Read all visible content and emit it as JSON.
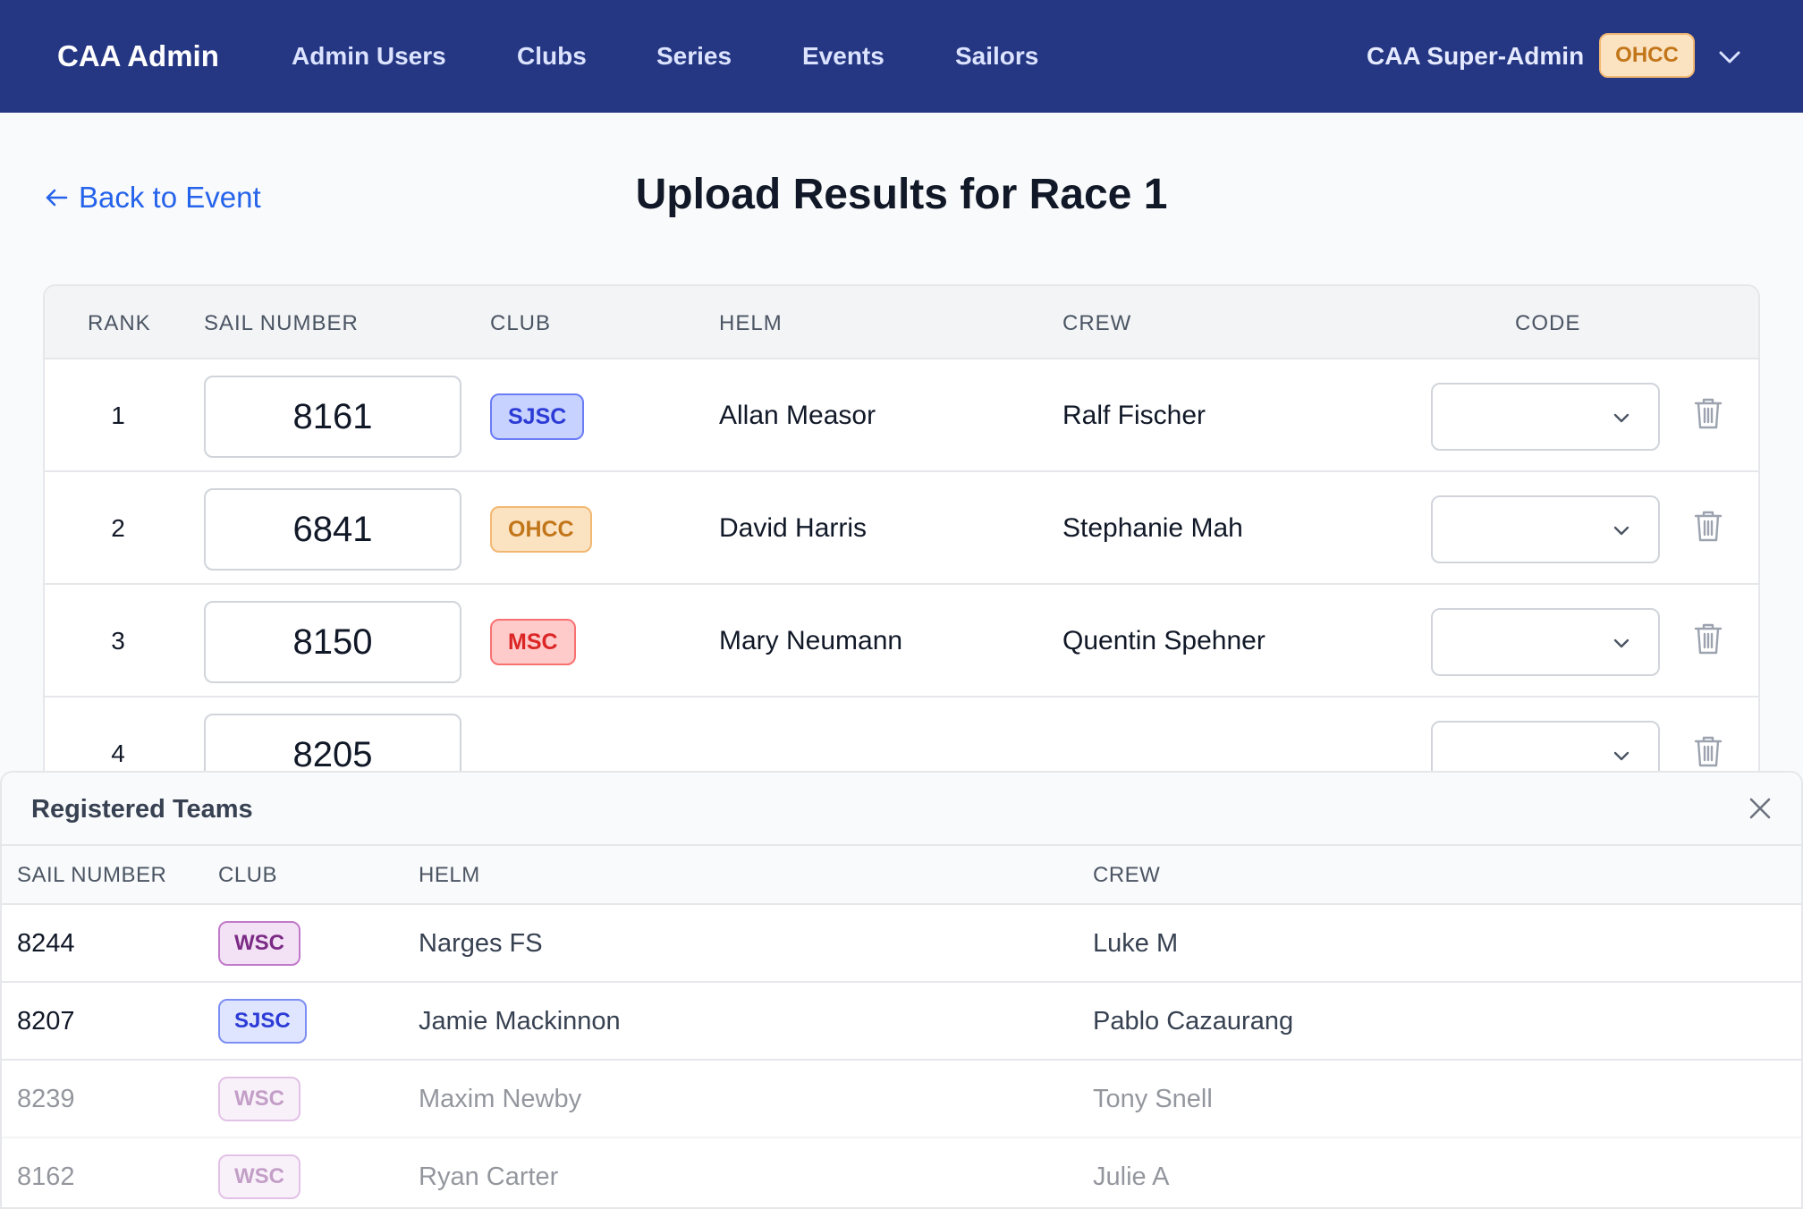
{
  "nav": {
    "brand": "CAA Admin",
    "links": [
      "Admin Users",
      "Clubs",
      "Series",
      "Events",
      "Sailors"
    ],
    "user_label": "CAA Super-Admin",
    "club_badge": "OHCC"
  },
  "header": {
    "back_label": "Back to Event",
    "title": "Upload Results for Race 1"
  },
  "results": {
    "columns": [
      "RANK",
      "SAIL NUMBER",
      "CLUB",
      "HELM",
      "CREW",
      "CODE"
    ],
    "rows": [
      {
        "rank": "1",
        "sail": "8161",
        "club": "SJSC",
        "helm": "Allan Measor",
        "crew": "Ralf Fischer",
        "code": ""
      },
      {
        "rank": "2",
        "sail": "6841",
        "club": "OHCC",
        "helm": "David Harris",
        "crew": "Stephanie Mah",
        "code": ""
      },
      {
        "rank": "3",
        "sail": "8150",
        "club": "MSC",
        "helm": "Mary Neumann",
        "crew": "Quentin Spehner",
        "code": ""
      },
      {
        "rank": "4",
        "sail": "8205",
        "club": "",
        "helm": "",
        "crew": "",
        "code": ""
      }
    ]
  },
  "registered": {
    "title": "Registered Teams",
    "columns": [
      "SAIL NUMBER",
      "CLUB",
      "HELM",
      "CREW"
    ],
    "rows": [
      {
        "sail": "8244",
        "club": "WSC",
        "helm": "Narges FS",
        "crew": "Luke M",
        "dimmed": false
      },
      {
        "sail": "8207",
        "club": "SJSC",
        "helm": "Jamie Mackinnon",
        "crew": "Pablo Cazaurang",
        "dimmed": false
      },
      {
        "sail": "8239",
        "club": "WSC",
        "helm": "Maxim Newby",
        "crew": "Tony Snell",
        "dimmed": true
      },
      {
        "sail": "8162",
        "club": "WSC",
        "helm": "Ryan Carter",
        "crew": "Julie A",
        "dimmed": true
      }
    ]
  },
  "colors": {
    "nav_bg": "#253682",
    "link": "#2563eb",
    "sjsc": "#2d3bd6",
    "ohcc": "#c2761a",
    "msc": "#dc2626",
    "wsc": "#7b2a85"
  }
}
